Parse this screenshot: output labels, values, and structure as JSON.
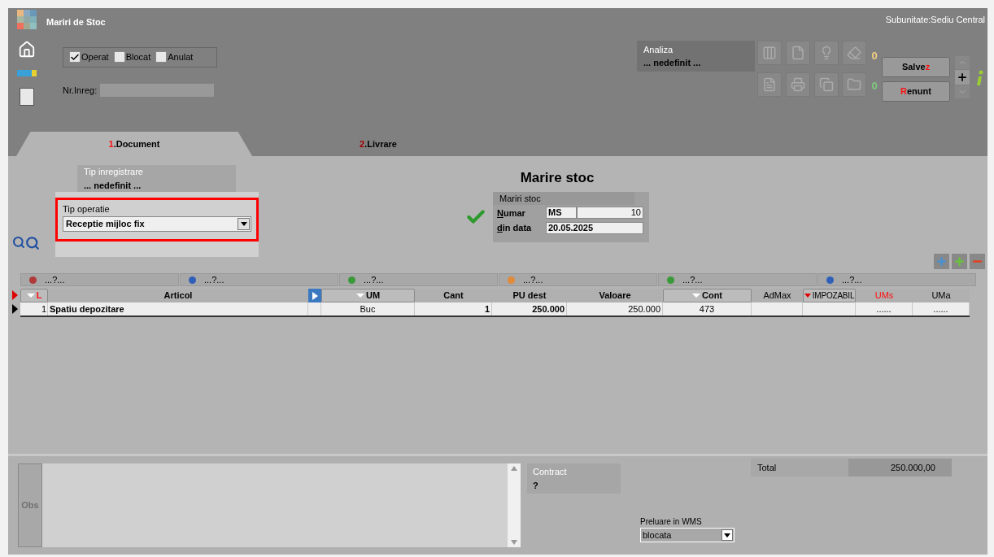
{
  "window": {
    "title": "Mariri de Stoc",
    "subunit": "Subunitate:Sediu Central"
  },
  "status_flags": [
    {
      "label": "Operat",
      "checked": true
    },
    {
      "label": "Blocat",
      "checked": false
    },
    {
      "label": "Anulat",
      "checked": false
    }
  ],
  "nr_inreg": {
    "label": "Nr.Inreg:"
  },
  "analiza": {
    "label": "Analiza",
    "value": "... nedefinit ..."
  },
  "counters": [
    {
      "value": "0",
      "color": "#f0d080"
    },
    {
      "value": "0",
      "color": "#7ec87e"
    }
  ],
  "buttons": [
    {
      "before": "Salve",
      "hotkey": "z"
    },
    {
      "hotkey": "R",
      "after": "enunt"
    }
  ],
  "tabs": [
    {
      "number": "1",
      "label": ".Document",
      "selected": true
    },
    {
      "number": "2",
      "label": ".Livrare",
      "selected": false
    }
  ],
  "tip_inregistrare": {
    "label": "Tip inregistrare",
    "value": "... nedefinit ..."
  },
  "tip_operatie": {
    "label": "Tip operatie",
    "value": "Receptie mijloc fix",
    "highlighted": true
  },
  "heading": "Marire stoc",
  "mariri_stoc": {
    "title": "Mariri stoc",
    "fields": [
      {
        "hotkey": "N",
        "after": "umar",
        "values": [
          "MS",
          "10"
        ]
      },
      {
        "hotkey": "d",
        "after": "in data",
        "values": [
          "20.05.2025"
        ]
      }
    ]
  },
  "groups": [
    {
      "label": "...?...",
      "color": "#b03a3a"
    },
    {
      "label": "...?...",
      "color": "#2f5fb8"
    },
    {
      "label": "...?...",
      "color": "#3a9a3a"
    },
    {
      "label": "...?...",
      "color": "#e08a3a"
    },
    {
      "label": "...?...",
      "color": "#3a9a3a"
    },
    {
      "label": "...?...",
      "color": "#2f5fb8"
    }
  ],
  "columns": [
    {
      "label": "L",
      "kind": "text",
      "sorted": true,
      "filtered": false,
      "red": true,
      "raised": true
    },
    {
      "label": "Articol",
      "kind": "text",
      "sorted": false,
      "filtered": false,
      "red": false,
      "raised": false
    },
    {
      "kind": "expander"
    },
    {
      "label": "UM",
      "kind": "text",
      "sorted": true,
      "filtered": false,
      "red": false,
      "raised": true
    },
    {
      "label": "Cant",
      "kind": "text",
      "sorted": false,
      "filtered": false,
      "red": false,
      "raised": false
    },
    {
      "label": "PU dest",
      "kind": "text",
      "sorted": false,
      "filtered": false,
      "red": false,
      "raised": false
    },
    {
      "label": "Valoare",
      "kind": "text",
      "sorted": false,
      "filtered": false,
      "red": false,
      "raised": false
    },
    {
      "label": "Cont",
      "kind": "text",
      "sorted": true,
      "filtered": false,
      "red": false,
      "raised": true
    },
    {
      "label": "AdMax",
      "kind": "text",
      "sorted": false,
      "filtered": false,
      "red": false,
      "raised": false
    },
    {
      "label": "IMPOZABIL",
      "kind": "text",
      "sorted": false,
      "filtered": true,
      "red": false,
      "raised": true
    },
    {
      "label": "UMs",
      "kind": "text",
      "sorted": false,
      "filtered": false,
      "red": true,
      "raised": false
    },
    {
      "label": "UMa",
      "kind": "text",
      "sorted": false,
      "filtered": false,
      "red": false,
      "raised": false
    }
  ],
  "rows": [
    {
      "selected": true,
      "cells": [
        "1",
        "Spatiu depozitare",
        null,
        "Buc",
        "1",
        "250.000",
        "250.000",
        "473",
        null,
        null,
        "......",
        "......"
      ]
    }
  ],
  "obs": {
    "label": "Obs"
  },
  "contract": {
    "label": "Contract",
    "value": "?"
  },
  "wms": {
    "label": "Preluare in WMS",
    "value": "blocata"
  },
  "total": {
    "label": "Total",
    "value": "250.000,00"
  }
}
